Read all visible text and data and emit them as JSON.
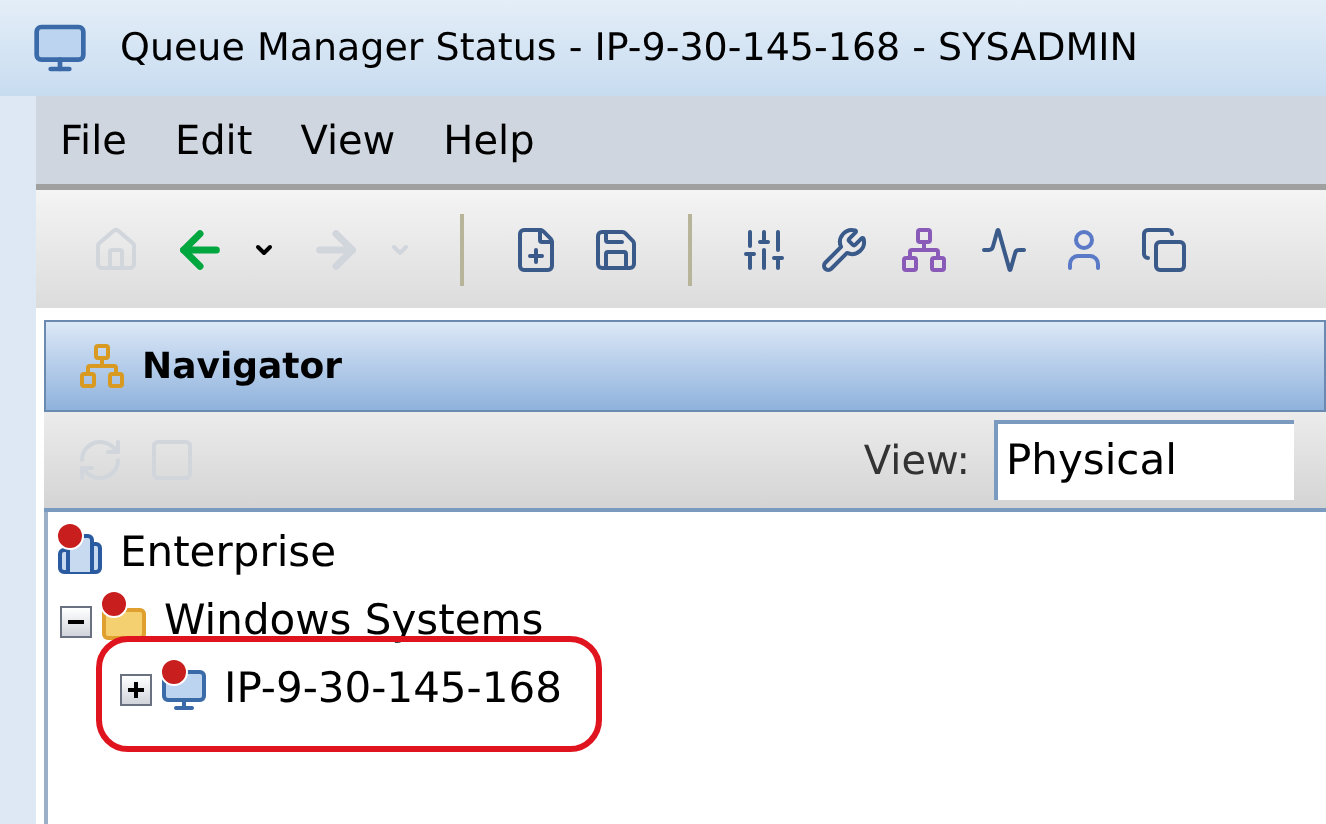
{
  "window": {
    "title": "Queue Manager Status - IP-9-30-145-168 - SYSADMIN"
  },
  "menu": [
    "File",
    "Edit",
    "View",
    "Help"
  ],
  "toolbar": [
    {
      "kind": "home",
      "disabled": true
    },
    {
      "kind": "back",
      "disabled": false
    },
    {
      "kind": "caret",
      "disabled": false
    },
    {
      "kind": "forward",
      "disabled": true
    },
    {
      "kind": "caret",
      "disabled": true
    },
    {
      "kind": "separator"
    },
    {
      "kind": "new",
      "disabled": false
    },
    {
      "kind": "save",
      "disabled": false
    },
    {
      "kind": "separator"
    },
    {
      "kind": "sliders",
      "disabled": false
    },
    {
      "kind": "wrench",
      "disabled": false
    },
    {
      "kind": "network",
      "disabled": false
    },
    {
      "kind": "activity",
      "disabled": false
    },
    {
      "kind": "user",
      "disabled": false
    },
    {
      "kind": "copy",
      "disabled": false
    }
  ],
  "navigator": {
    "title": "Navigator",
    "view_label": "View:",
    "view_value": "Physical",
    "tree": [
      {
        "label": "Enterprise",
        "kind": "enterprise",
        "error": true,
        "children": [
          {
            "label": "Windows Systems",
            "kind": "folder",
            "error": true,
            "expanded": true,
            "children": [
              {
                "label": "IP-9-30-145-168",
                "kind": "computer",
                "error": true,
                "expanded": false,
                "highlighted": true
              }
            ]
          }
        ]
      }
    ]
  }
}
